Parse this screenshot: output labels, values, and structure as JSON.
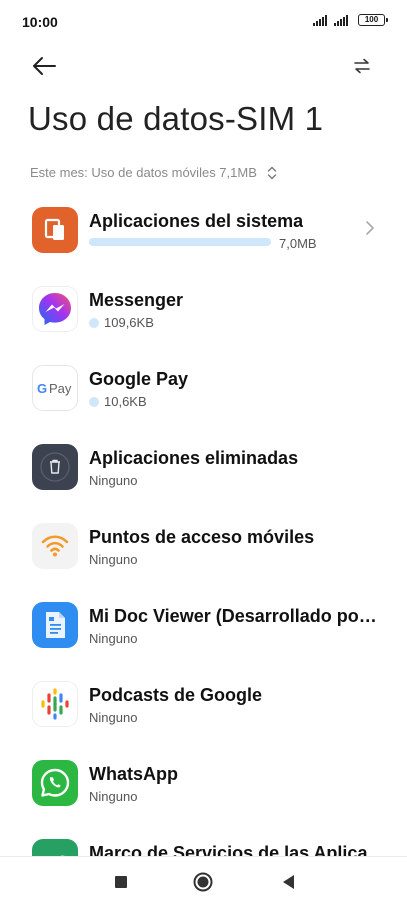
{
  "status_bar": {
    "time": "10:00",
    "battery": "100"
  },
  "toolbar": {
    "back_icon": "arrow-left-icon",
    "swap_icon": "swap-arrows-icon"
  },
  "page": {
    "title": "Uso de datos-SIM 1",
    "summary": "Este mes: Uso de datos móviles 7,1MB"
  },
  "apps": [
    {
      "name": "Aplicaciones del sistema",
      "usage": "7,0MB",
      "usage_fraction": 0.98,
      "icon": "system-apps-icon",
      "colors": {
        "bg": "#e2622b"
      }
    },
    {
      "name": "Messenger",
      "usage": "109,6KB",
      "icon": "messenger-icon",
      "colors": {
        "bg": "#ffffff"
      }
    },
    {
      "name": "Google Pay",
      "usage": "10,6KB",
      "icon": "google-pay-icon",
      "colors": {
        "bg": "#ffffff"
      }
    },
    {
      "name": "Aplicaciones eliminadas",
      "usage": "Ninguno",
      "icon": "trash-icon",
      "colors": {
        "bg": "#3d4250"
      }
    },
    {
      "name": "Puntos de acceso móviles",
      "usage": "Ninguno",
      "icon": "wifi-hotspot-icon",
      "colors": {
        "bg": "#f3f3f3"
      }
    },
    {
      "name": "Mi Doc Viewer (Desarrollado por…",
      "usage": "Ninguno",
      "icon": "doc-viewer-icon",
      "colors": {
        "bg": "#2f8cf0"
      }
    },
    {
      "name": "Podcasts de Google",
      "usage": "Ninguno",
      "icon": "google-podcasts-icon",
      "colors": {
        "bg": "#ffffff"
      }
    },
    {
      "name": "WhatsApp",
      "usage": "Ninguno",
      "icon": "whatsapp-icon",
      "colors": {
        "bg": "#2bb741"
      }
    },
    {
      "name": "Marco de Servicios de las Aplica",
      "usage": "",
      "icon": "services-framework-icon",
      "colors": {
        "bg": "#27a064"
      }
    }
  ],
  "colors": {
    "usage_bar": "#cfe6fb",
    "accent_text": "#8a8a8a"
  },
  "nav": {
    "recents_icon": "square-icon",
    "home_icon": "circle-icon",
    "back_icon": "triangle-back-icon"
  }
}
